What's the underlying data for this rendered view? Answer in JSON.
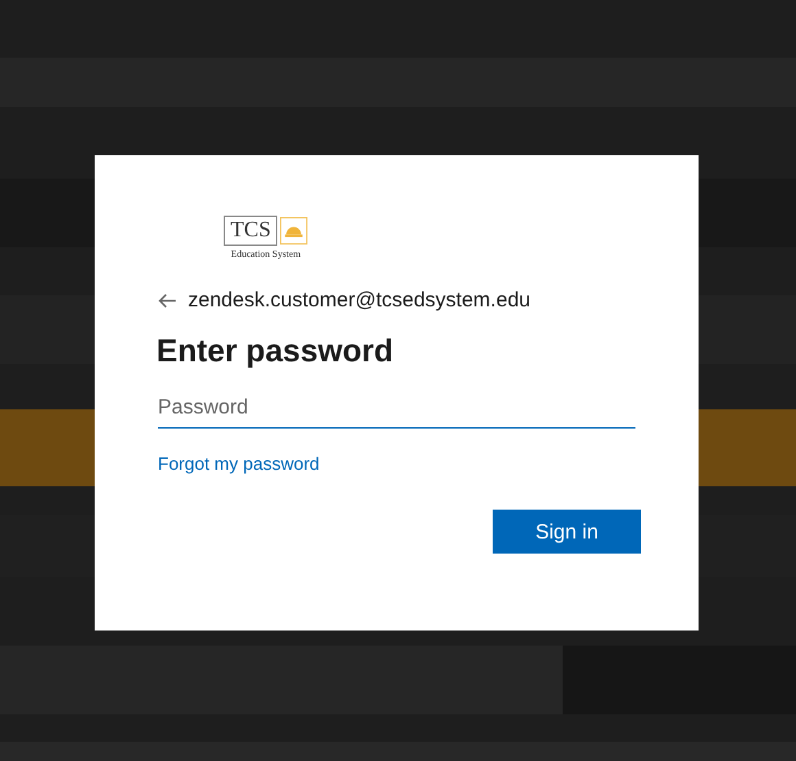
{
  "logo": {
    "mark": "TCS",
    "tagline": "Education System"
  },
  "account": {
    "email": "zendesk.customer@tcsedsystem.edu"
  },
  "title": "Enter password",
  "password_field": {
    "placeholder": "Password"
  },
  "forgot_link": "Forgot my password",
  "buttons": [
    "Sign in"
  ]
}
